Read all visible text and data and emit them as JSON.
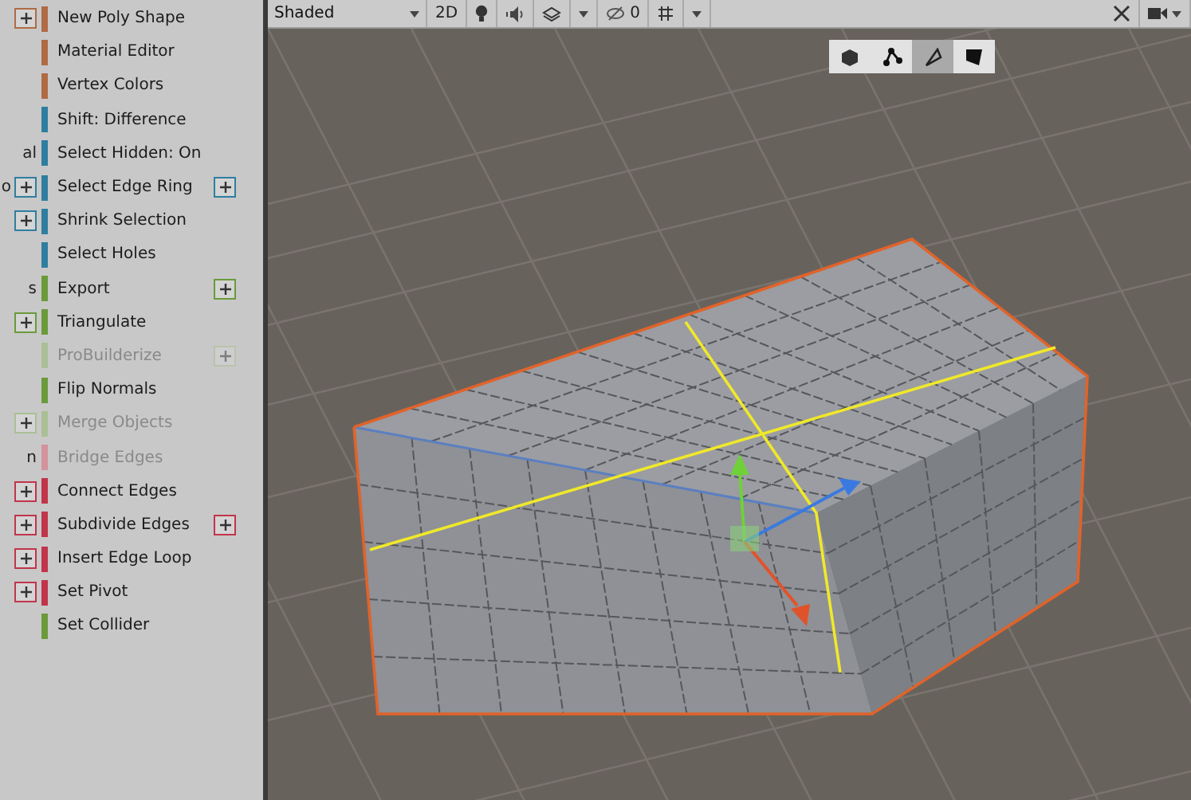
{
  "tool_panel": {
    "rows": [
      {
        "label": "New Poly Shape",
        "color": "#b06a44",
        "disabled": false,
        "options": false,
        "left_options": true
      },
      {
        "label": "Material Editor",
        "color": "#b06a44",
        "disabled": false,
        "options": false,
        "left_options": false
      },
      {
        "label": "Vertex Colors",
        "color": "#b06a44",
        "disabled": false,
        "options": false,
        "left_options": false
      },
      {
        "label": "Shift: Difference",
        "color": "#2f7ea0",
        "disabled": false,
        "options": false,
        "left_options": false
      },
      {
        "label": "Select Hidden: On",
        "color": "#2f7ea0",
        "disabled": false,
        "options": false,
        "left_options": false,
        "left_fragment": "al"
      },
      {
        "label": "Select Edge Ring",
        "color": "#2f7ea0",
        "disabled": false,
        "options": true,
        "left_options": true,
        "left_fragment": "o"
      },
      {
        "label": "Shrink Selection",
        "color": "#2f7ea0",
        "disabled": false,
        "options": false,
        "left_options": true
      },
      {
        "label": "Select Holes",
        "color": "#2f7ea0",
        "disabled": false,
        "options": false,
        "left_options": false
      },
      {
        "label": "Export",
        "color": "#6a9a3a",
        "disabled": false,
        "options": true,
        "left_options": false,
        "left_fragment": "s"
      },
      {
        "label": "Triangulate",
        "color": "#6a9a3a",
        "disabled": false,
        "options": false,
        "left_options": true
      },
      {
        "label": "ProBuilderize",
        "color": "#aabf94",
        "disabled": true,
        "options": true,
        "left_options": false
      },
      {
        "label": "Flip Normals",
        "color": "#6a9a3a",
        "disabled": false,
        "options": false,
        "left_options": false
      },
      {
        "label": "Merge Objects",
        "color": "#aabf94",
        "disabled": true,
        "options": false,
        "left_options": true
      },
      {
        "label": "Bridge Edges",
        "color": "#d3929c",
        "disabled": true,
        "options": false,
        "left_options": false,
        "left_fragment": "n"
      },
      {
        "label": "Connect Edges",
        "color": "#c0354a",
        "disabled": false,
        "options": false,
        "left_options": true
      },
      {
        "label": "Subdivide Edges",
        "color": "#c0354a",
        "disabled": false,
        "options": true,
        "left_options": true
      },
      {
        "label": "Insert Edge Loop",
        "color": "#c0354a",
        "disabled": false,
        "options": false,
        "left_options": true
      },
      {
        "label": "Set Pivot",
        "color": "#c0354a",
        "disabled": false,
        "options": false,
        "left_options": true
      },
      {
        "label": "Set Collider",
        "color": "#6a9a3a",
        "disabled": false,
        "options": false,
        "left_options": false
      }
    ]
  },
  "scene_toolbar": {
    "shading_mode": "Shaded",
    "mode_2d": "2D",
    "hidden_count": "0"
  },
  "selection_modes": [
    {
      "kind": "object",
      "selected": false
    },
    {
      "kind": "vertex",
      "selected": false
    },
    {
      "kind": "edge",
      "selected": true
    },
    {
      "kind": "face",
      "selected": false
    }
  ]
}
